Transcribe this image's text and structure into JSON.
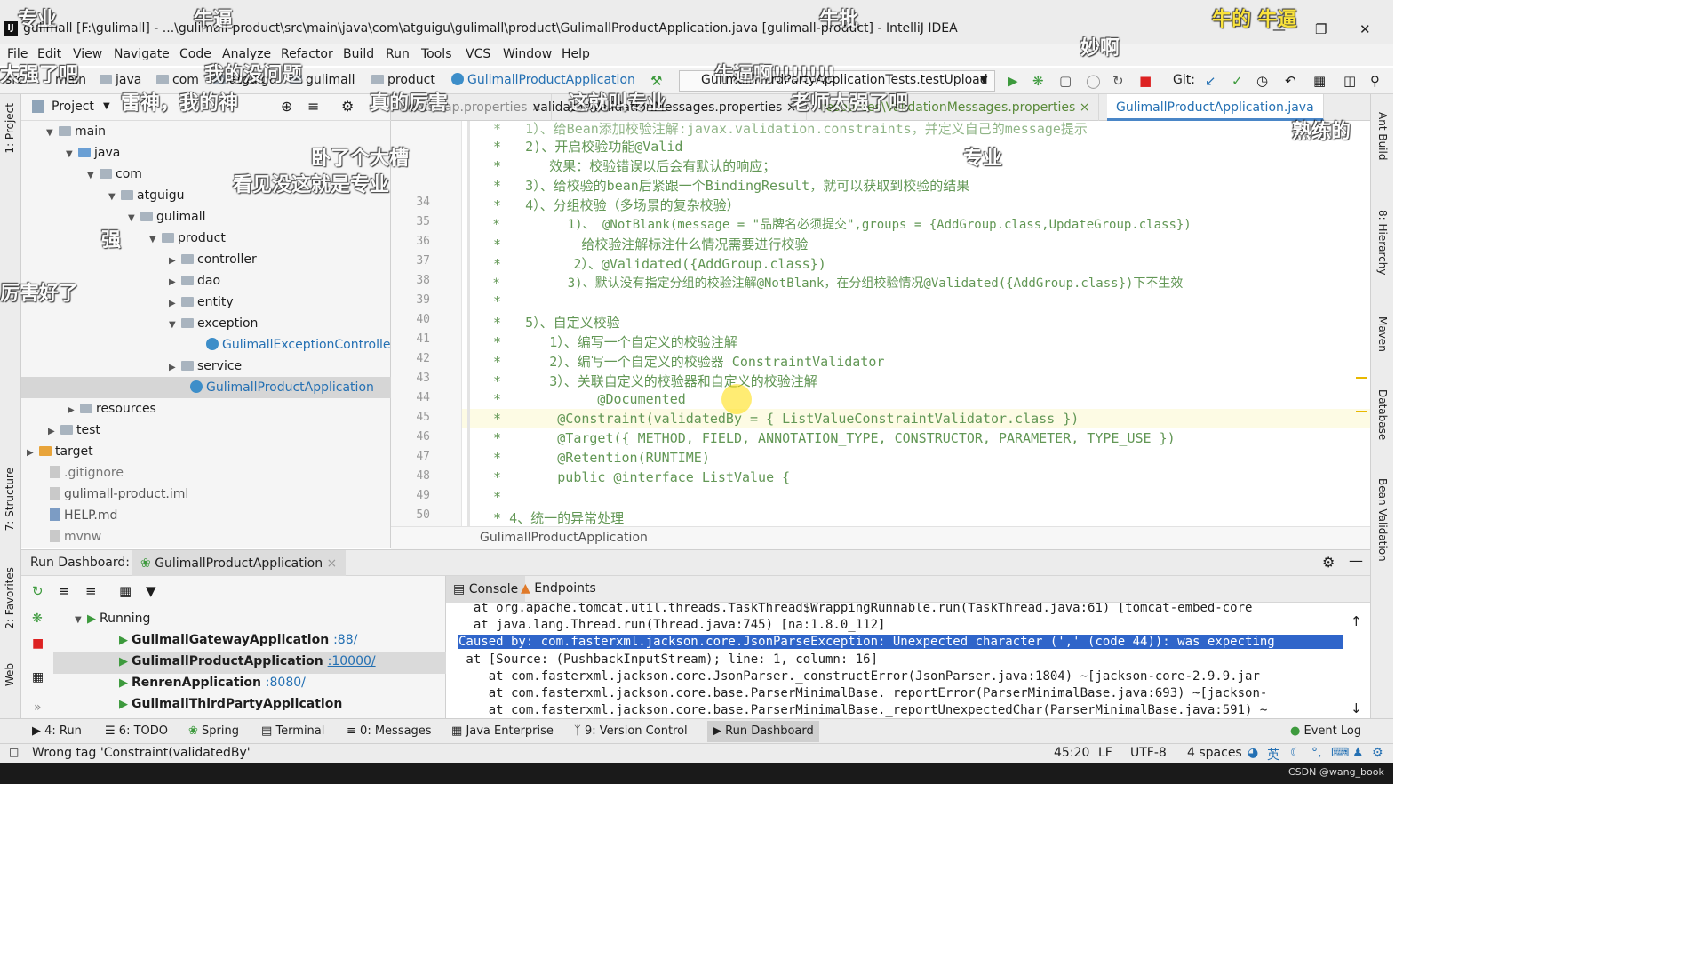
{
  "window": {
    "title": "gulimall [F:\\gulimall] - ...\\gulimall-product\\src\\main\\java\\com\\atguigu\\gulimall\\product\\GulimallProductApplication.java [gulimall-product] - IntelliJ IDEA",
    "logo": "IJ"
  },
  "menu": [
    "File",
    "Edit",
    "View",
    "Navigate",
    "Code",
    "Analyze",
    "Refactor",
    "Build",
    "Run",
    "Tools",
    "VCS",
    "Window",
    "Help"
  ],
  "breadcrumbs": [
    "src",
    "main",
    "java",
    "com",
    "atguigu",
    "gulimall",
    "product",
    "GulimallProductApplication"
  ],
  "run_config": "GulimallThirdPartyApplicationTests.testUpload",
  "git_label": "Git:",
  "project": {
    "header": "Project",
    "tree": [
      {
        "label": "main",
        "arrow": "down"
      },
      {
        "label": "java",
        "arrow": "down"
      },
      {
        "label": "com",
        "arrow": "down"
      },
      {
        "label": "atguigu",
        "arrow": "down"
      },
      {
        "label": "gulimall",
        "arrow": "down"
      },
      {
        "label": "product",
        "arrow": "down"
      },
      {
        "label": "controller",
        "arrow": "right"
      },
      {
        "label": "dao",
        "arrow": "right"
      },
      {
        "label": "entity",
        "arrow": "right"
      },
      {
        "label": "exception",
        "arrow": "down"
      },
      {
        "label": "GulimallExceptionControllerAdvice",
        "arrow": ""
      },
      {
        "label": "service",
        "arrow": "right"
      },
      {
        "label": "GulimallProductApplication",
        "arrow": ""
      },
      {
        "label": "resources",
        "arrow": "right"
      },
      {
        "label": "test",
        "arrow": "right"
      },
      {
        "label": "target",
        "arrow": "right"
      },
      {
        "label": ".gitignore",
        "arrow": ""
      },
      {
        "label": "gulimall-product.iml",
        "arrow": ""
      },
      {
        "label": "HELP.md",
        "arrow": ""
      },
      {
        "label": "mvnw",
        "arrow": ""
      }
    ]
  },
  "editor_tabs": [
    "bootstrap.properties",
    "validator\\ValidationMessages.properties",
    "resources\\ValidationMessages.properties",
    "GulimallProductApplication.java"
  ],
  "line_numbers": [
    "34",
    "35",
    "36",
    "37",
    "38",
    "39",
    "40",
    "41",
    "42",
    "43",
    "44",
    "45",
    "46",
    "47",
    "48",
    "49",
    "50"
  ],
  "code_lines": [
    " *   1）、给Bean添加校验注解:javax.validation.constraints，并定义自己的message提示",
    " *   2)、开启校验功能@Valid",
    " *      效果：校验错误以后会有默认的响应；",
    " *   3）、给校验的bean后紧跟一个BindingResult，就可以获取到校验的结果",
    " *   4）、分组校验（多场景的复杂校验）",
    " *         1)、 @NotBlank(message = \"品牌名必须提交\",groups = {AddGroup.class,UpdateGroup.class})",
    " *          给校验注解标注什么情况需要进行校验",
    " *         2）、@Validated({AddGroup.class})",
    " *         3)、默认没有指定分组的校验注解@NotBlank，在分组校验情况@Validated({AddGroup.class})下不生效",
    " *",
    " *   5）、自定义校验",
    " *      1）、编写一个自定义的校验注解",
    " *      2）、编写一个自定义的校验器 ConstraintValidator",
    " *      3）、关联自定义的校验器和自定义的校验注解",
    " *            @Documented",
    " *       @Constraint(validatedBy = { ListValueConstraintValidator.class })",
    " *       @Target({ METHOD, FIELD, ANNOTATION_TYPE, CONSTRUCTOR, PARAMETER, TYPE_USE })",
    " *       @Retention(RUNTIME)",
    " *       public @interface ListValue {",
    " *",
    " * 4、统一的异常处理"
  ],
  "editor_breadcrumb": "GulimallProductApplication",
  "run_dashboard": {
    "label": "Run Dashboard:",
    "tab": "GulimallProductApplication",
    "group": "Running",
    "apps": [
      {
        "name": "GulimallGatewayApplication",
        "port": ":88/"
      },
      {
        "name": "GulimallProductApplication",
        "port": ":10000/"
      },
      {
        "name": "RenrenApplication",
        "port": ":8080/"
      },
      {
        "name": "GulimallThirdPartyApplication",
        "port": ""
      }
    ]
  },
  "console": {
    "tabs": [
      "Console",
      "Endpoints"
    ],
    "lines": [
      "  at org.apache.tomcat.util.threads.TaskThread$WrappingRunnable.run(TaskThread.java:61) [tomcat-embed-core",
      "  at java.lang.Thread.run(Thread.java:745) [na:1.8.0_112]",
      "Caused by: com.fasterxml.jackson.core.JsonParseException: Unexpected character (',' (code 44)): was expecting",
      " at [Source: (PushbackInputStream); line: 1, column: 16]",
      "    at com.fasterxml.jackson.core.JsonParser._constructError(JsonParser.java:1804) ~[jackson-core-2.9.9.jar",
      "    at com.fasterxml.jackson.core.base.ParserMinimalBase._reportError(ParserMinimalBase.java:693) ~[jackson-",
      "    at com.fasterxml.jackson.core.base.ParserMinimalBase._reportUnexpectedChar(ParserMinimalBase.java:591) ~"
    ]
  },
  "tool_tabs": [
    "4: Run",
    "6: TODO",
    "Spring",
    "Terminal",
    "0: Messages",
    "Java Enterprise",
    "9: Version Control",
    "Run Dashboard",
    "Event Log"
  ],
  "left_tabs": [
    "1: Project",
    "7: Structure",
    "2: Favorites",
    "Web"
  ],
  "right_tabs": [
    "Ant Build",
    "8: Hierarchy",
    "Maven",
    "Database",
    "Bean Validation"
  ],
  "status": {
    "message": "Wrong tag 'Constraint(validatedBy'",
    "position": "45:20",
    "line_sep": "LF",
    "encoding": "UTF-8",
    "indent": "4 spaces",
    "ime": "英"
  },
  "watermark": "CSDN @wang_book",
  "danmaku": [
    "专业",
    "牛逼",
    "牛批",
    "牛的 牛逼",
    "大强了吧",
    "我的没问题",
    "雷神，我的神",
    "真的厉害",
    "这就叫专业",
    "牛逼啊!!!!!!!",
    "老师太强了吧",
    "卧了个大槽",
    "看见没这就是专业",
    "强",
    "厉害好了",
    "妙啊",
    "熟练的",
    "专业"
  ],
  "colors": {
    "accent": "#2470b3",
    "selection": "#2f65ca",
    "comment": "#629755",
    "annotation": "#9b7a00"
  }
}
